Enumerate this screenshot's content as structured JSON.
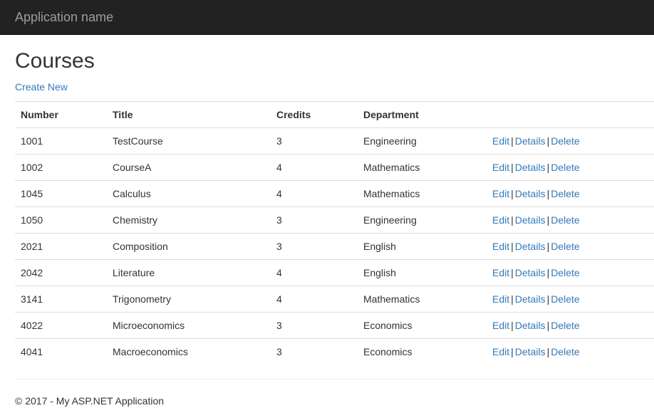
{
  "navbar": {
    "brand": "Application name"
  },
  "page": {
    "title": "Courses",
    "create_new": "Create New"
  },
  "table": {
    "headers": {
      "number": "Number",
      "title": "Title",
      "credits": "Credits",
      "department": "Department"
    },
    "actions": {
      "edit": "Edit",
      "details": "Details",
      "delete": "Delete",
      "separator": "|"
    },
    "rows": [
      {
        "number": "1001",
        "title": "TestCourse",
        "credits": "3",
        "department": "Engineering"
      },
      {
        "number": "1002",
        "title": "CourseA",
        "credits": "4",
        "department": "Mathematics"
      },
      {
        "number": "1045",
        "title": "Calculus",
        "credits": "4",
        "department": "Mathematics"
      },
      {
        "number": "1050",
        "title": "Chemistry",
        "credits": "3",
        "department": "Engineering"
      },
      {
        "number": "2021",
        "title": "Composition",
        "credits": "3",
        "department": "English"
      },
      {
        "number": "2042",
        "title": "Literature",
        "credits": "4",
        "department": "English"
      },
      {
        "number": "3141",
        "title": "Trigonometry",
        "credits": "4",
        "department": "Mathematics"
      },
      {
        "number": "4022",
        "title": "Microeconomics",
        "credits": "3",
        "department": "Economics"
      },
      {
        "number": "4041",
        "title": "Macroeconomics",
        "credits": "3",
        "department": "Economics"
      }
    ]
  },
  "footer": {
    "text": "© 2017 - My ASP.NET Application"
  },
  "colors": {
    "navbar_bg": "#222222",
    "brand_text": "#9d9d9d",
    "link": "#337ab7",
    "border": "#dddddd"
  }
}
